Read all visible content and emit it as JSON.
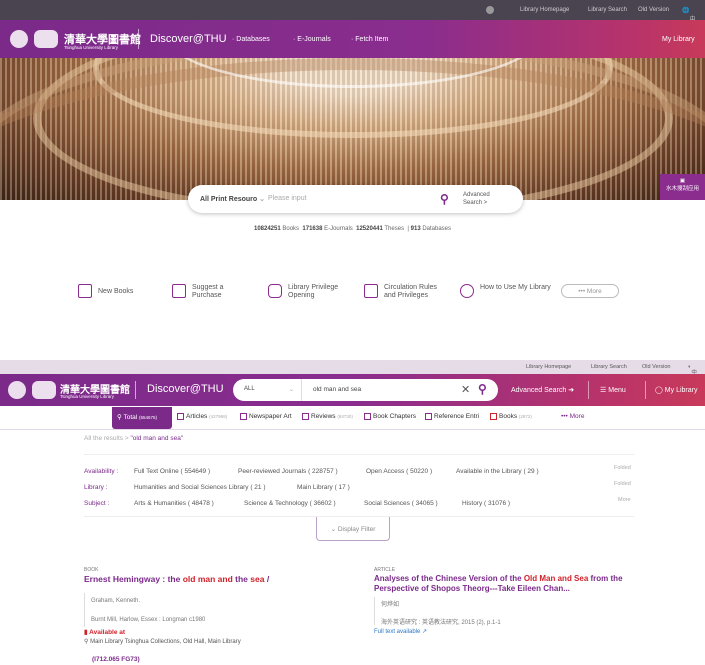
{
  "top": {
    "links": [
      "Library Homepage",
      "Library Search",
      "Old Version",
      "中文"
    ]
  },
  "header": {
    "brand": "Discover@THU",
    "nav": [
      "Databases",
      "E-Journals",
      "Fetch Item"
    ],
    "my_library": "My Library",
    "school_en": "Tsinghua University Library",
    "school_cn": "清華大學圖書館"
  },
  "search": {
    "scope": "All Print Resouro",
    "placeholder": "Please input",
    "advanced": "Advanced Search >"
  },
  "stats": {
    "books_n": "10824251",
    "books": "Books",
    "ejournals_n": "171638",
    "ejournals": "E-Journals",
    "theses_n": "12520441",
    "theses": "Theses",
    "db_n": "913",
    "db": "Databases"
  },
  "quick": [
    "New Books",
    "Suggest a Purchase",
    "Library Privilege Opening",
    "Circulation Rules and Privileges",
    "How to Use My Library",
    "More"
  ],
  "side_tab": "水木搜刮应用",
  "strip": {
    "links": [
      "Library Homepage",
      "Library Search",
      "Old Version",
      "中文"
    ]
  },
  "header2": {
    "brand": "Discover@THU",
    "scope": "ALL",
    "query": "old man and sea",
    "advanced": "Advanced Search",
    "menu": "Menu",
    "my_library": "My Library"
  },
  "tabs": {
    "total": "Total",
    "total_n": "(554675)",
    "articles": "Articles",
    "articles_n": "(427969)",
    "newspaper": "Newspaper Art",
    "reviews": "Reviews",
    "reviews_n": "(84730)",
    "chapters": "Book Chapters",
    "reference": "Reference Entri",
    "books": "Books",
    "books_n": "(2872)",
    "more": "More"
  },
  "breadcrumb": {
    "root": "All the results >",
    "query": "\"old man and sea\""
  },
  "facets": [
    {
      "label": "Availability :",
      "items": [
        "Full Text Online ( 554649 )",
        "Peer-reviewed Journals ( 228757 )",
        "Open Access ( 50220 )",
        "Available in the Library ( 29 )"
      ],
      "toggle": "Folded"
    },
    {
      "label": "Library :",
      "items": [
        "Humanities and Social Sciences Library ( 21 )",
        "Main Library ( 17 )"
      ],
      "toggle": "Folded"
    },
    {
      "label": "Subject :",
      "items": [
        "Arts & Humanities ( 48478 )",
        "Science & Technology ( 36602 )",
        "Social Sciences ( 34065 )",
        "History ( 31076 )"
      ],
      "toggle": "More"
    }
  ],
  "display_filter": "Display Filter",
  "results": [
    {
      "type": "BOOK",
      "title_parts": [
        "Ernest Hemingway : the ",
        "old man and",
        " the ",
        "sea",
        " /"
      ],
      "author": "Graham, Kenneth.",
      "publisher": "Burnt Mill, Harlow, Essex : Longman c1980",
      "available": "Available at",
      "location": "Main Library Tsinghua Collections, Old Hall, Main Library",
      "callno": "(I712.065 FG73)"
    },
    {
      "type": "ARTICLE",
      "title_pre": "Analyses of the Chinese Version of the ",
      "title_hl": "Old Man and Sea",
      "title_post": " from the Perspective of Shopos Theorg---Take Eileen Chan...",
      "author": "何烨如",
      "source": "海外英语研究 : 英语教法研究, 2015 (2), p.1-1",
      "fulltext": "Full text available"
    }
  ]
}
